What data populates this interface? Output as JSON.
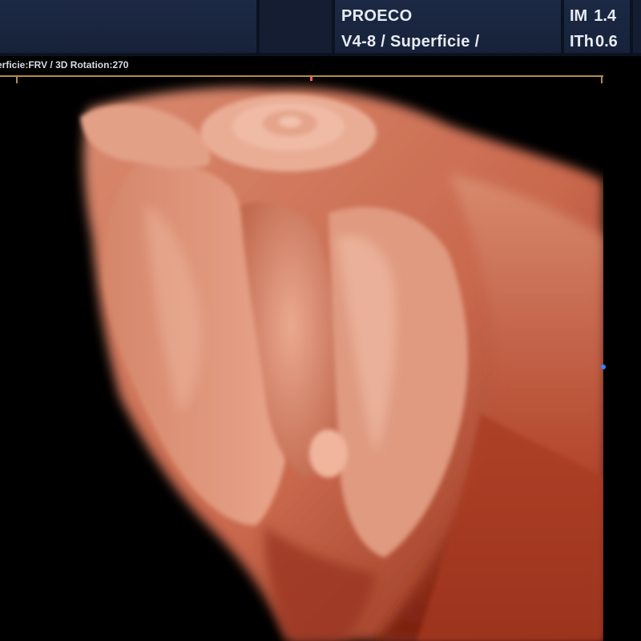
{
  "header": {
    "probe_line_1": "PROECO",
    "probe_line_2": "V4-8 / Superficie /",
    "index_1_label": "IM",
    "index_1_value": "1.4",
    "index_2_label": "ITh",
    "index_2_value": "0.6"
  },
  "status": {
    "render_info": "erficie:FRV / 3D Rotation:270"
  },
  "colors": {
    "background": "#000000",
    "header_panel": "#1c2944",
    "frame_line": "#b58a4c",
    "marker_red": "#ff5a5a",
    "marker_blue": "#3f7fff",
    "tissue_light": "#e6a086",
    "tissue_dark": "#8a2a14"
  }
}
